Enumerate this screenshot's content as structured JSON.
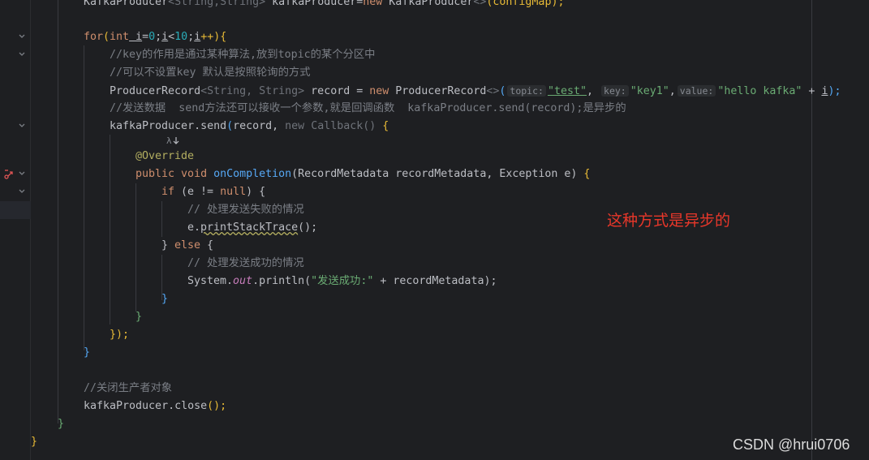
{
  "annotation": "这种方式是异步的",
  "watermark": "CSDN @hrui0706",
  "code": {
    "l1_a": "KafkaProducer",
    "l1_b": "<String,String>",
    "l1_c": " kafkaProducer=",
    "l1_d": "new",
    "l1_e": " KafkaProducer",
    "l1_f": "<>",
    "l1_g": "(configMap);",
    "for_kw": "for",
    "for_rest_1": "(",
    "for_int": "int",
    "for_var_i1": " i",
    "for_eq": "=",
    "for_zero": "0",
    "for_semi1": ";",
    "for_var_i2": "i",
    "for_lt": "<",
    "for_ten": "10",
    "for_semi2": ";",
    "for_var_i3": "i",
    "for_inc": "++)",
    "for_brace": "{",
    "comment1": "//key的作用是通过某种算法,放到topic的某个分区中",
    "comment2": "//可以不设置key 默认是按照轮询的方式",
    "pr_type": "ProducerRecord",
    "pr_generic": "<String, String>",
    "pr_mid": " record = ",
    "pr_new": "new",
    "pr_ctor": " ProducerRecord",
    "pr_diamond": "<>",
    "pr_paren": "(",
    "hint_topic": "topic:",
    "pr_test": "\"test\"",
    "pr_comma1": ",",
    "hint_key": "key:",
    "pr_key1": "\"key1\"",
    "pr_comma2": ",",
    "hint_value": "value:",
    "pr_hello": "\"hello kafka\"",
    "pr_plus": " + ",
    "pr_i": "i",
    "pr_end": ");",
    "comment3": "//发送数据  send方法还可以接收一个参数,就是回调函数  kafkaProducer.send(record);是异步的",
    "send_a": "kafkaProducer.send",
    "send_b": "(",
    "send_c": "record, ",
    "send_new": "new",
    "send_cb": " Callback",
    "send_pp": "()",
    "send_brace": " {",
    "override": "@Override",
    "oc_public": "public",
    "oc_void": " void",
    "oc_name": " onCompletion",
    "oc_args": "(RecordMetadata recordMetadata, Exception e)",
    "oc_brace": " {",
    "if_kw": "if",
    "if_cond_a": " (e != ",
    "if_null": "null",
    "if_cond_b": ") {",
    "comment4": "// 处理发送失败的情况",
    "pst_a": "e.",
    "pst_b": "printStackTrace",
    "pst_c": "();",
    "else_a": "} ",
    "else_kw": "else",
    "else_b": " {",
    "comment5": "// 处理发送成功的情况",
    "sys_a": "System.",
    "sys_out": "out",
    "sys_b": ".println(",
    "sys_str": "\"发送成功:\"",
    "sys_c": " + recordMetadata);",
    "close_b1": "}",
    "close_b2": "}",
    "close_b3": "});",
    "close_b4": "}",
    "comment6": "//关闭生产者对象",
    "close_call_a": "kafkaProducer.close",
    "close_call_b": "();",
    "close_b5": "}",
    "close_b6": "}"
  }
}
